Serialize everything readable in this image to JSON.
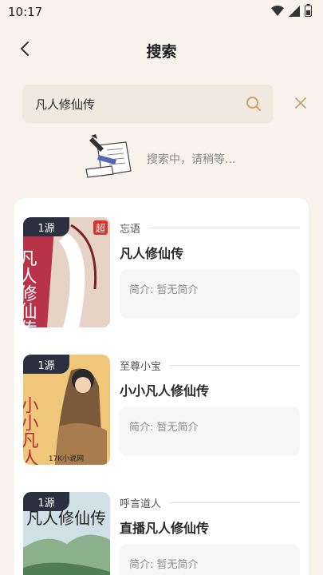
{
  "status_bar": {
    "time": "10:17",
    "icons": [
      "wifi-icon",
      "signal-icon",
      "battery-icon"
    ]
  },
  "header": {
    "back_icon": "chevron-left-icon",
    "title": "搜索"
  },
  "search": {
    "value": "凡人修仙传",
    "search_icon": "search-icon",
    "close_icon": "close-icon"
  },
  "loading": {
    "text": "搜索中，请稍等..."
  },
  "results": [
    {
      "source": "1源",
      "author": "忘语",
      "title": "凡人修仙传",
      "intro": "简介: 暂无简介",
      "cover": {
        "bg": "#b8324a",
        "fg": "#f0d7c8",
        "text": "凡人修仙传",
        "corner": "超"
      }
    },
    {
      "source": "1源",
      "author": "至尊小宝",
      "title": "小小凡人修仙传",
      "intro": "简介: 暂无简介",
      "cover": {
        "bg": "#f0c77a",
        "fg": "#b2303a",
        "text": "小小凡人修仙传",
        "footer": "17K小说网"
      }
    },
    {
      "source": "1源",
      "author": "呼言道人",
      "title": "直播凡人修仙传",
      "intro": "简介: 暂无简介",
      "cover": {
        "bg": "#cfe0e6",
        "fg": "#1e1e1e",
        "text": "凡人修仙传"
      }
    }
  ],
  "colors": {
    "background": "#f7f2eb",
    "accent": "#c9a16a",
    "badge": "#2b3040"
  }
}
